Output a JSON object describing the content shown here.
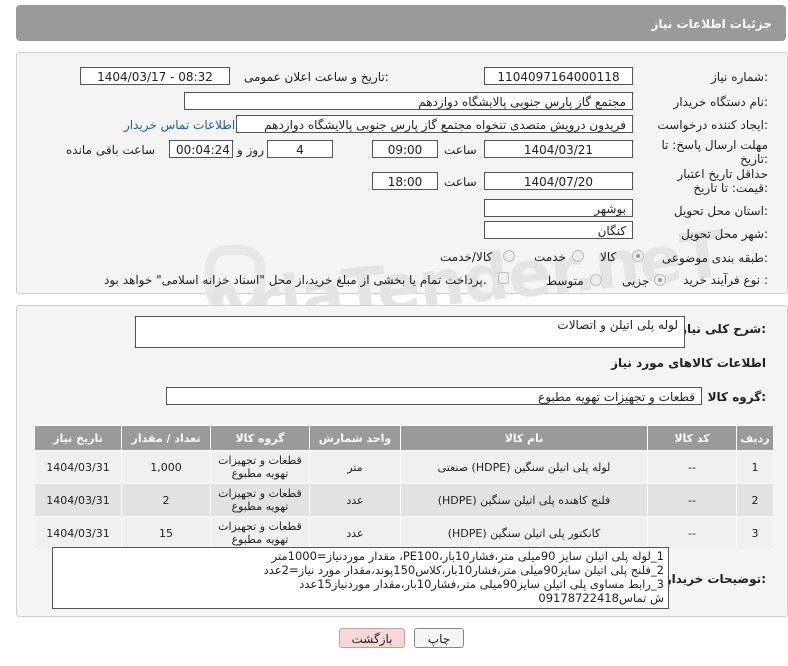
{
  "header": {
    "title": "جزئیات اطلاعات نیاز"
  },
  "form": {
    "need_number_label": "شماره نیاز:",
    "need_number": "1104097164000118",
    "announce_label": "تاریخ و ساعت اعلان عمومی:",
    "announce_value": "1404/03/17 - 08:32",
    "buyer_label": "نام دستگاه خریدار:",
    "buyer_value": "مجتمع گاز پارس جنوبی  پالایشگاه دوازدهم",
    "creator_label": "ایجاد کننده درخواست:",
    "creator_value": "فریدون درویش متصدی تنخواه مجتمع گاز پارس جنوبی  پالایشگاه دوازدهم",
    "contact_link": "اطلاعات تماس خریدار",
    "deadline_label": "مهلت ارسال پاسخ: تا تاریخ:",
    "deadline_date": "1404/03/21",
    "time_label": "ساعت",
    "deadline_time": "09:00",
    "days_value": "4",
    "days_label": "روز و",
    "remaining_time": "00:04:24",
    "remaining_label": "ساعت باقی مانده",
    "validity_label": "حداقل تاریخ اعتبار قیمت: تا تاریخ:",
    "validity_date": "1404/07/20",
    "validity_time": "18:00",
    "province_label": "استان محل تحویل:",
    "province_value": "بوشهر",
    "city_label": "شهر محل تحویل:",
    "city_value": "کنگان",
    "category_label": "طبقه بندی موضوعی:",
    "category_options": [
      "کالا",
      "خدمت",
      "کالا/خدمت"
    ],
    "process_label": "نوع فرآیند خرید :",
    "process_options": [
      "جزیی",
      "متوسط"
    ],
    "payment_note": "پرداخت تمام یا بخشی از مبلغ خرید،از محل \"اسناد خزانه اسلامی\" خواهد بود."
  },
  "summary": {
    "label": "شرح کلی نیاز:",
    "value": "لوله پلی اتیلن و اتصالات"
  },
  "goods_info_title": "اطلاعات کالاهای مورد نیاز",
  "goods_group": {
    "label": "گروه کالا:",
    "value": "قطعات و تجهیزات تهویه مطبوع"
  },
  "table": {
    "headers": [
      "ردیف",
      "کد کالا",
      "نام کالا",
      "واحد شمارش",
      "گروه کالا",
      "تعداد / مقدار",
      "تاریخ نیاز"
    ],
    "rows": [
      {
        "idx": "1",
        "code": "--",
        "name": "لوله پلی اتیلن سنگین (HDPE) صنعتی",
        "unit": "متر",
        "group": "قطعات و تجهیزات تهویه مطبوع",
        "qty": "1,000",
        "date": "1404/03/31"
      },
      {
        "idx": "2",
        "code": "--",
        "name": "فلنج کاهنده پلی اتیلن سنگین (HDPE)",
        "unit": "عدد",
        "group": "قطعات و تجهیزات تهویه مطبوع",
        "qty": "2",
        "date": "1404/03/31"
      },
      {
        "idx": "3",
        "code": "--",
        "name": "کانکتور پلی اتیلن سنگین (HDPE)",
        "unit": "عدد",
        "group": "قطعات و تجهیزات تهویه مطبوع",
        "qty": "15",
        "date": "1404/03/31"
      }
    ]
  },
  "buyer_notes": {
    "label": "توضیحات خریدار:",
    "lines": [
      "1_لوله پلی اتیلن سایز 90میلی متر،فشار10بار،PE100، مقدار موردنیاز=1000متر",
      "2_فلنج پلی اتیلن سایز90میلی متر،فشار10بار،کلاس150پوند،مقدار مورد نیاز=2عدد",
      "3_رابط مساوی پلی اتیلن سایز90میلی متر،فشار10بار،مقدار موردنیاز15عدد",
      "ش تماس09178722418"
    ]
  },
  "buttons": {
    "print": "چاپ",
    "back": "بازگشت"
  },
  "watermark": "AriaTender.neT"
}
